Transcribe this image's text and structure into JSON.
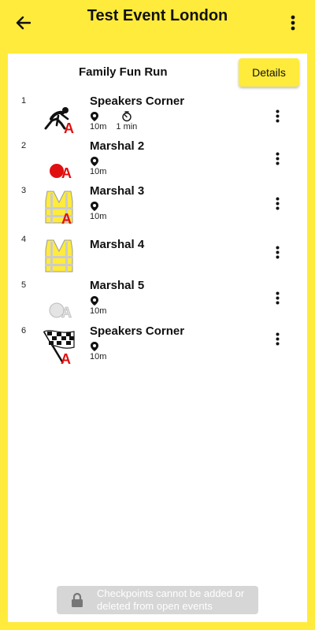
{
  "appbar": {
    "title": "Test Event London",
    "back_icon": "arrow-back-icon",
    "menu_icon": "more-vertical-icon"
  },
  "route": {
    "title": "Family Fun Run",
    "details_label": "Details"
  },
  "checkpoints": [
    {
      "number": "1",
      "name": "Speakers Corner",
      "icon": "start-runner-icon",
      "distance": "10m",
      "time": "1 min"
    },
    {
      "number": "2",
      "name": "Marshal 2",
      "icon": "red-dot-icon",
      "distance": "10m"
    },
    {
      "number": "3",
      "name": "Marshal 3",
      "icon": "hi-vis-vest-icon",
      "distance": "10m"
    },
    {
      "number": "4",
      "name": "Marshal 4",
      "icon": "hi-vis-vest-icon"
    },
    {
      "number": "5",
      "name": "Marshal 5",
      "icon": "grey-dot-icon",
      "distance": "10m"
    },
    {
      "number": "6",
      "name": "Speakers Corner",
      "icon": "finish-flag-icon",
      "distance": "10m"
    }
  ],
  "notice": {
    "text": "Checkpoints cannot be added or deleted from open events",
    "icon": "lock-icon"
  },
  "colors": {
    "brand_yellow": "#FFEB3B",
    "accent_red": "#E01010",
    "notice_grey": "#D6D6D6"
  }
}
